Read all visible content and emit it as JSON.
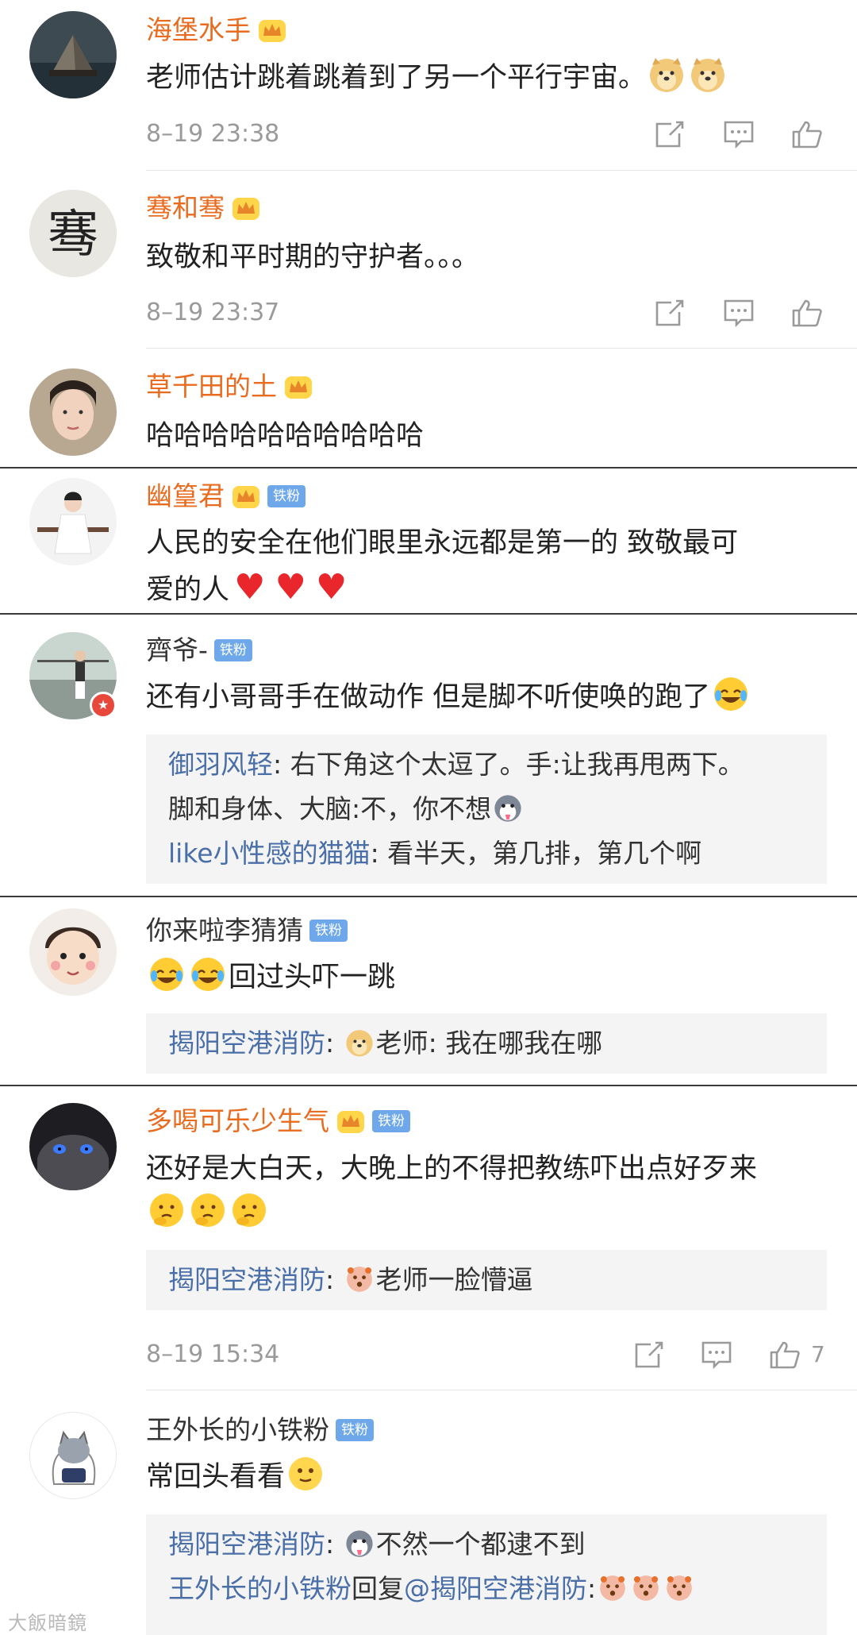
{
  "comments": [
    {
      "username": "海堡水手",
      "text": "老师估计跳着跳着到了另一个平行宇宙。",
      "emoji": [
        "doge",
        "doge"
      ],
      "time": "8–19 23:38"
    },
    {
      "username": "骞和骞",
      "avatar_text": "骞",
      "text": "致敬和平时期的守护者。。。",
      "time": "8–19 23:37"
    },
    {
      "username": "草千田的土",
      "text": "哈哈哈哈哈哈哈哈哈哈"
    },
    {
      "username": "幽篁君",
      "badge": "铁粉",
      "text_line1": "人民的安全在他们眼里永远都是第一的  致敬最可",
      "text_line2": "爱的人"
    },
    {
      "username": "齊爷-",
      "badge": "铁粉",
      "text": "还有小哥哥手在做动作 但是脚不听使唤的跑了",
      "replies": [
        {
          "name": "御羽风轻",
          "text": ": 右下角这个太逗了。手:让我再甩两下。"
        },
        {
          "text": "脚和身体、大脑:不，你不想"
        },
        {
          "name": "like小性感的猫猫",
          "text": ": 看半天，第几排，第几个啊"
        }
      ]
    },
    {
      "username": "你来啦李猜猜",
      "badge": "铁粉",
      "text": "回过头吓一跳",
      "replies": [
        {
          "name": "揭阳空港消防",
          "text": "老师:  我在哪我在哪"
        }
      ]
    },
    {
      "username": "多喝可乐少生气",
      "badge": "铁粉",
      "text": "还好是大白天，大晚上的不得把教练吓出点好歹来",
      "replies": [
        {
          "name": "揭阳空港消防",
          "text": "老师一脸懵逼"
        }
      ],
      "time": "8–19 15:34",
      "like_count": "7"
    },
    {
      "username": "王外长的小铁粉",
      "badge": "铁粉",
      "text": "常回头看看",
      "replies": [
        {
          "name": "揭阳空港消防",
          "text": "不然一个都逮不到"
        },
        {
          "name": "王外长的小铁粉",
          "text": "回复",
          "mention": "@揭阳空港消防",
          "suffix": ":"
        }
      ]
    }
  ],
  "icons": {
    "share": "share-icon",
    "reply": "comment-icon",
    "like": "thumbs-up-icon",
    "vip": "crown-icon",
    "verified": "verified-badge-icon"
  },
  "colors": {
    "vip_name": "#e86b1f",
    "reply_name": "#4a6fa8",
    "fan_badge": "#6ea8ea",
    "time": "#9a9a9a",
    "heart": "#e8262c"
  },
  "watermark": "大飯暗鏡"
}
